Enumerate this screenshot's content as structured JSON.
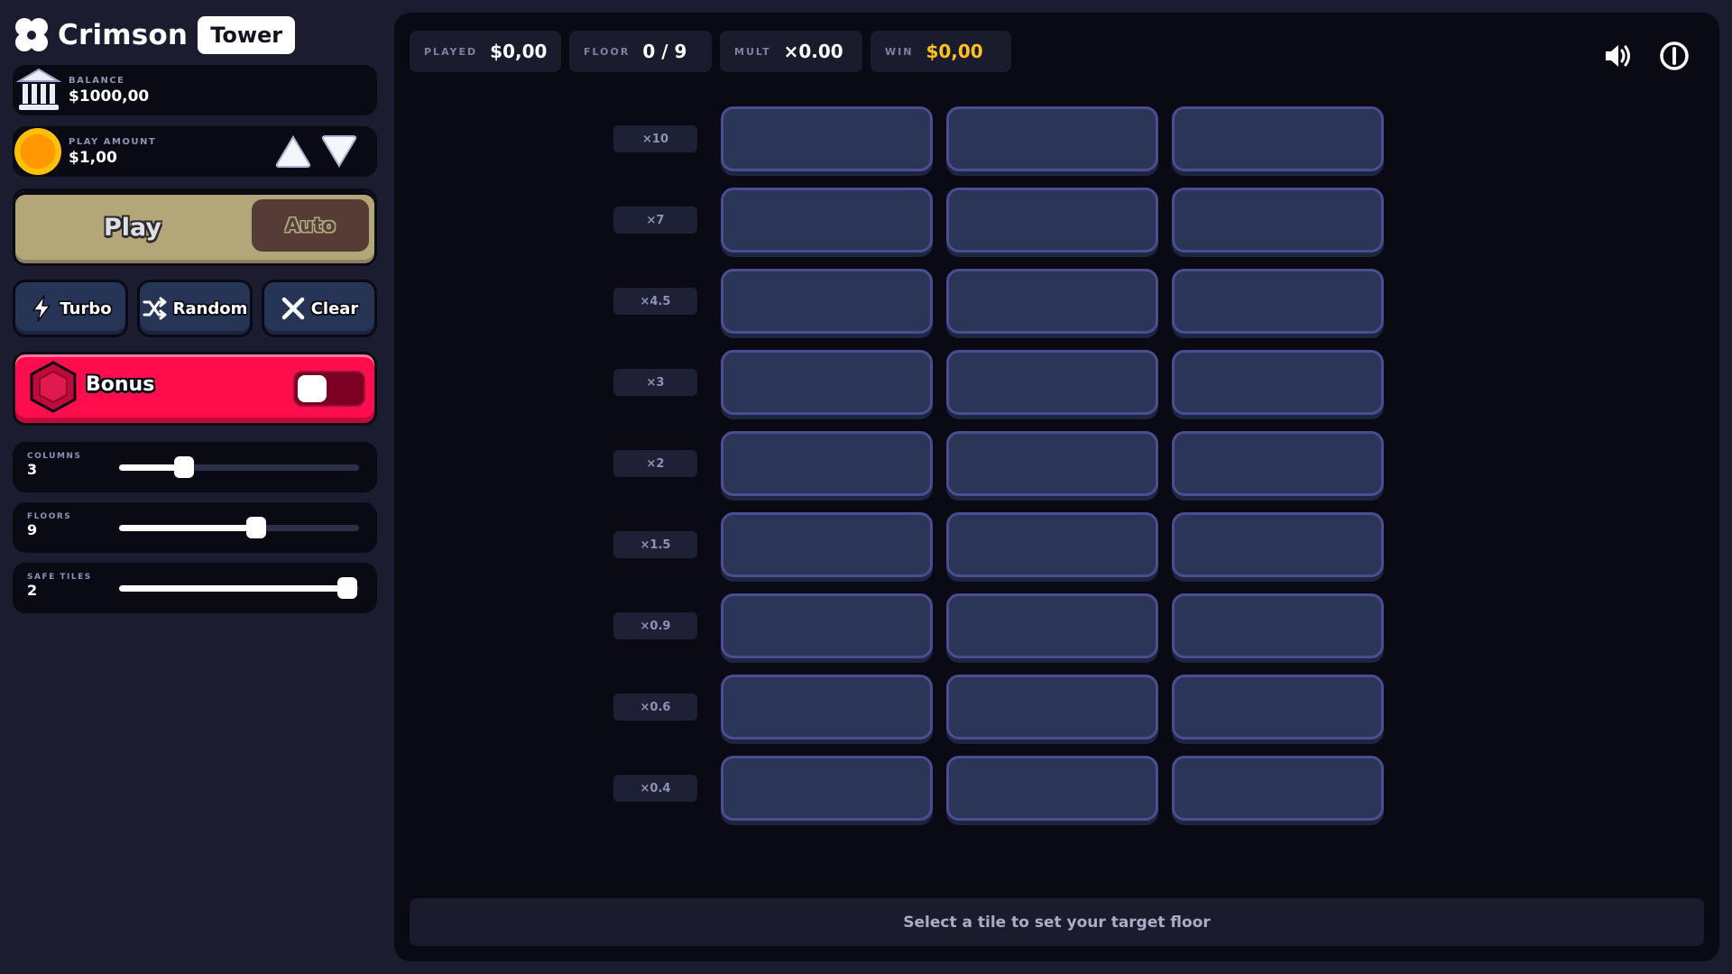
{
  "brand": {
    "name": "Crimson",
    "badge": "Tower"
  },
  "balance": {
    "label": "BALANCE",
    "value": "$1000,00"
  },
  "play_amount": {
    "label": "PLAY AMOUNT",
    "value": "$1,00"
  },
  "actions": {
    "play": "Play",
    "auto": "Auto"
  },
  "tools": {
    "turbo": "Turbo",
    "random": "Random",
    "clear": "Clear"
  },
  "bonus": {
    "label": "Bonus",
    "enabled": false
  },
  "sliders": [
    {
      "label": "COLUMNS",
      "value": "3",
      "fraction": 0.27
    },
    {
      "label": "FLOORS",
      "value": "9",
      "fraction": 0.57
    },
    {
      "label": "SAFE TILES",
      "value": "2",
      "fraction": 0.95
    }
  ],
  "stats": {
    "played": {
      "label": "PLAYED",
      "value": "$0,00"
    },
    "floor": {
      "label": "FLOOR",
      "value": "0 / 9"
    },
    "mult": {
      "label": "MULT",
      "value": "×0.00"
    },
    "win": {
      "label": "WIN",
      "value": "$0,00"
    }
  },
  "floors": [
    {
      "multiplier": "×10"
    },
    {
      "multiplier": "×7"
    },
    {
      "multiplier": "×4.5"
    },
    {
      "multiplier": "×3"
    },
    {
      "multiplier": "×2"
    },
    {
      "multiplier": "×1.5"
    },
    {
      "multiplier": "×0.9"
    },
    {
      "multiplier": "×0.6"
    },
    {
      "multiplier": "×0.4"
    }
  ],
  "columns_count": 3,
  "message": "Select a tile to set your target floor",
  "colors": {
    "accent_gold": "#ffc21a",
    "bonus_red": "#ff0d4c",
    "tile_fill": "#2a3558",
    "tile_border": "#4b4c92"
  },
  "icons": {
    "logo": "clover-logo-icon",
    "balance": "bank-icon",
    "amount": "coin-icon",
    "turbo": "lightning-icon",
    "random": "shuffle-icon",
    "clear": "close-icon",
    "bonus": "hexagon-gem-icon",
    "sound": "speaker-icon",
    "info": "info-icon"
  }
}
